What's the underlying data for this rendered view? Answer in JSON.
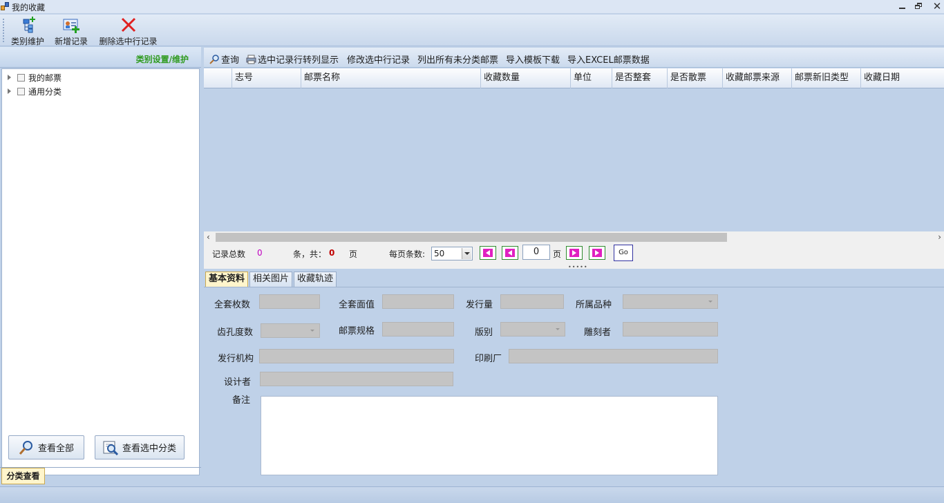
{
  "window": {
    "title": "我的收藏"
  },
  "toolbar": {
    "category_label": "类别维护",
    "add_label": "新增记录",
    "delete_label": "删除选中行记录"
  },
  "left": {
    "header": "类别设置/维护",
    "tree": [
      "我的邮票",
      "通用分类"
    ],
    "view_all": "查看全部",
    "view_selected": "查看选中分类",
    "tab": "分类查看"
  },
  "grid_toolbar": {
    "query": "查询",
    "transpose": "选中记录行转列显示",
    "edit": "修改选中行记录",
    "list_unclassified": "列出所有未分类邮票",
    "download_template": "导入模板下载",
    "import_excel": "导入EXCEL邮票数据"
  },
  "grid": {
    "columns": [
      "志号",
      "邮票名称",
      "收藏数量",
      "单位",
      "是否整套",
      "是否散票",
      "收藏邮票来源",
      "邮票新旧类型",
      "收藏日期"
    ]
  },
  "pager": {
    "total_label": "记录总数",
    "total": "0",
    "pages_label": "条，共：",
    "pages": "0",
    "page_unit": "页",
    "per_page_label": "每页条数:",
    "per_page": "50",
    "current_page": "0",
    "current_unit": "页",
    "go": "Go"
  },
  "detail": {
    "tabs": [
      "基本资料",
      "相关图片",
      "收藏轨迹"
    ],
    "fields": {
      "set_count": "全套枚数",
      "set_value": "全套面值",
      "issue_qty": "发行量",
      "category": "所属品种",
      "perforation": "齿孔度数",
      "spec": "邮票规格",
      "edition": "版别",
      "engraver": "雕刻者",
      "issuer": "发行机构",
      "printer": "印刷厂",
      "designer": "设计者",
      "remark": "备注"
    }
  }
}
